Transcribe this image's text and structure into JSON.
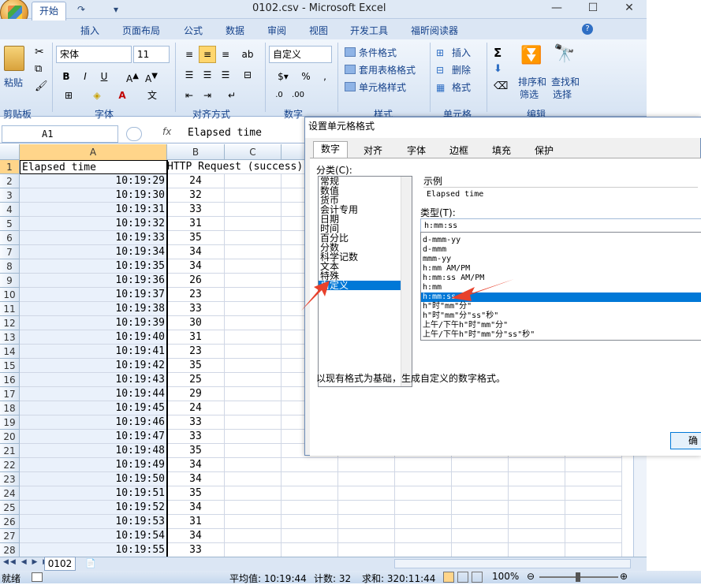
{
  "window": {
    "title": "0102.csv - Microsoft Excel",
    "min": "—",
    "max": "☐",
    "close": "✕"
  },
  "ribbon": {
    "tabs": [
      "开始",
      "插入",
      "页面布局",
      "公式",
      "数据",
      "审阅",
      "视图",
      "开发工具",
      "福昕阅读器"
    ],
    "groups": [
      "剪贴板",
      "字体",
      "对齐方式",
      "数字",
      "样式",
      "单元格",
      "编辑"
    ],
    "paste": "粘贴",
    "font_name": "宋体",
    "font_size": "11",
    "number_format": "自定义",
    "styles": [
      "条件格式",
      "套用表格格式",
      "单元格样式"
    ],
    "cells": [
      "插入",
      "删除",
      "格式"
    ],
    "edit": [
      "排序和",
      "筛选",
      "查找和",
      "选择"
    ],
    "bold": "B",
    "italic": "I",
    "underline": "U"
  },
  "formula_bar": {
    "name_box": "A1",
    "fx": "fx",
    "content": "Elapsed time"
  },
  "columns": [
    "A",
    "B",
    "C"
  ],
  "rows": [
    {
      "n": "1",
      "a": "Elapsed time",
      "b": "HTTP Request (success)"
    },
    {
      "n": "2",
      "a": "10:19:29",
      "b": "24"
    },
    {
      "n": "3",
      "a": "10:19:30",
      "b": "32"
    },
    {
      "n": "4",
      "a": "10:19:31",
      "b": "33"
    },
    {
      "n": "5",
      "a": "10:19:32",
      "b": "31"
    },
    {
      "n": "6",
      "a": "10:19:33",
      "b": "35"
    },
    {
      "n": "7",
      "a": "10:19:34",
      "b": "34"
    },
    {
      "n": "8",
      "a": "10:19:35",
      "b": "34"
    },
    {
      "n": "9",
      "a": "10:19:36",
      "b": "26"
    },
    {
      "n": "10",
      "a": "10:19:37",
      "b": "23"
    },
    {
      "n": "11",
      "a": "10:19:38",
      "b": "33"
    },
    {
      "n": "12",
      "a": "10:19:39",
      "b": "30"
    },
    {
      "n": "13",
      "a": "10:19:40",
      "b": "31"
    },
    {
      "n": "14",
      "a": "10:19:41",
      "b": "23"
    },
    {
      "n": "15",
      "a": "10:19:42",
      "b": "35"
    },
    {
      "n": "16",
      "a": "10:19:43",
      "b": "25"
    },
    {
      "n": "17",
      "a": "10:19:44",
      "b": "29"
    },
    {
      "n": "18",
      "a": "10:19:45",
      "b": "24"
    },
    {
      "n": "19",
      "a": "10:19:46",
      "b": "33"
    },
    {
      "n": "20",
      "a": "10:19:47",
      "b": "33"
    },
    {
      "n": "21",
      "a": "10:19:48",
      "b": "35"
    },
    {
      "n": "22",
      "a": "10:19:49",
      "b": "34"
    },
    {
      "n": "23",
      "a": "10:19:50",
      "b": "34"
    },
    {
      "n": "24",
      "a": "10:19:51",
      "b": "35"
    },
    {
      "n": "25",
      "a": "10:19:52",
      "b": "34"
    },
    {
      "n": "26",
      "a": "10:19:53",
      "b": "31"
    },
    {
      "n": "27",
      "a": "10:19:54",
      "b": "34"
    },
    {
      "n": "28",
      "a": "10:19:55",
      "b": "33"
    }
  ],
  "sheet_tab": "0102",
  "status": {
    "ready": "就绪",
    "average": "平均值: 10:19:44",
    "count": "计数: 32",
    "sum": "求和: 320:11:44",
    "zoom": "100%"
  },
  "dialog": {
    "title": "设置单元格格式",
    "tabs": [
      "数字",
      "对齐",
      "字体",
      "边框",
      "填充",
      "保护"
    ],
    "category_label": "分类(C):",
    "categories": [
      "常规",
      "数值",
      "货币",
      "会计专用",
      "日期",
      "时间",
      "百分比",
      "分数",
      "科学记数",
      "文本",
      "特殊",
      "自定义"
    ],
    "sample_label": "示例",
    "sample_value": "Elapsed time",
    "type_label": "类型(T):",
    "type_value": "h:mm:ss",
    "types": [
      "d-mmm-yy",
      "d-mmm",
      "mmm-yy",
      "h:mm AM/PM",
      "h:mm:ss AM/PM",
      "h:mm",
      "h:mm:ss",
      "h\"时\"mm\"分\"",
      "h\"时\"mm\"分\"ss\"秒\"",
      "上午/下午h\"时\"mm\"分\"",
      "上午/下午h\"时\"mm\"分\"ss\"秒\""
    ],
    "description": "以现有格式为基础，生成自定义的数字格式。",
    "ok": "确"
  },
  "colors": {
    "accent": "#0078d7",
    "ribbon_text": "#15428b",
    "annotation": "#e8412c"
  }
}
